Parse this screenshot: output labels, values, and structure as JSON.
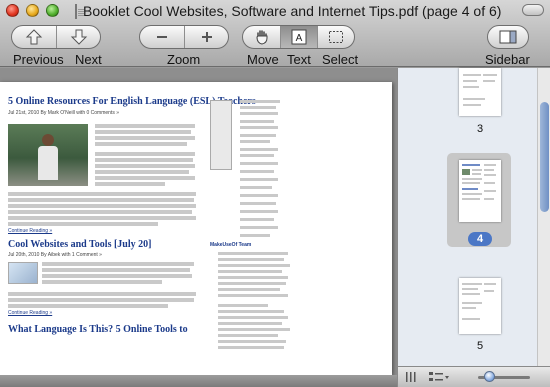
{
  "window": {
    "title": "Booklet Cool Websites, Software and Internet Tips.pdf (page 4 of 6)"
  },
  "toolbar": {
    "previous_label": "Previous",
    "next_label": "Next",
    "zoom_label": "Zoom",
    "move_label": "Move",
    "text_label": "Text",
    "select_label": "Select",
    "sidebar_label": "Sidebar"
  },
  "document": {
    "article1_title": "5 Online Resources For English Language (ESL) Teachers",
    "article1_meta": "Jul 21st, 2010 By Mark O'Neill with 0 Comments »",
    "read_more": "Continue Reading »",
    "article2_title": "Cool Websites and Tools [July 20]",
    "article2_meta": "Jul 20th, 2010 By Aibek with 1 Comment »",
    "article3_title": "What Language Is This? 5 Online Tools to",
    "side_heading": "MakeUseOf Team"
  },
  "sidebar": {
    "thumbnails": [
      {
        "page": "3"
      },
      {
        "page": "4",
        "selected": true
      },
      {
        "page": "5"
      }
    ]
  }
}
